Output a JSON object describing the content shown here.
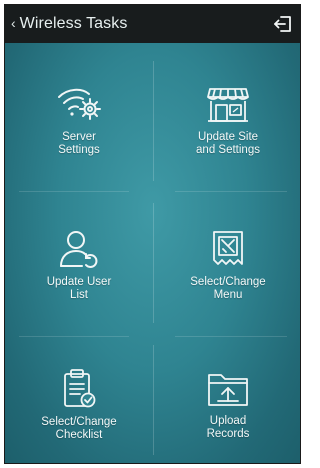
{
  "header": {
    "title": "Wireless Tasks",
    "back_glyph": "‹",
    "exit_icon": "logout-icon"
  },
  "tiles": [
    {
      "label": "Server\nSettings",
      "icon": "wifi-gear-icon"
    },
    {
      "label": "Update Site\nand Settings",
      "icon": "storefront-icon"
    },
    {
      "label": "Update User\nList",
      "icon": "user-refresh-icon"
    },
    {
      "label": "Select/Change\nMenu",
      "icon": "menu-card-icon"
    },
    {
      "label": "Select/Change\nChecklist",
      "icon": "clipboard-check-icon"
    },
    {
      "label": "Upload\nRecords",
      "icon": "folder-upload-icon"
    }
  ],
  "colors": {
    "header": "#181c1d",
    "background": "#2f8491",
    "icon_stroke": "#f1f6f6"
  }
}
